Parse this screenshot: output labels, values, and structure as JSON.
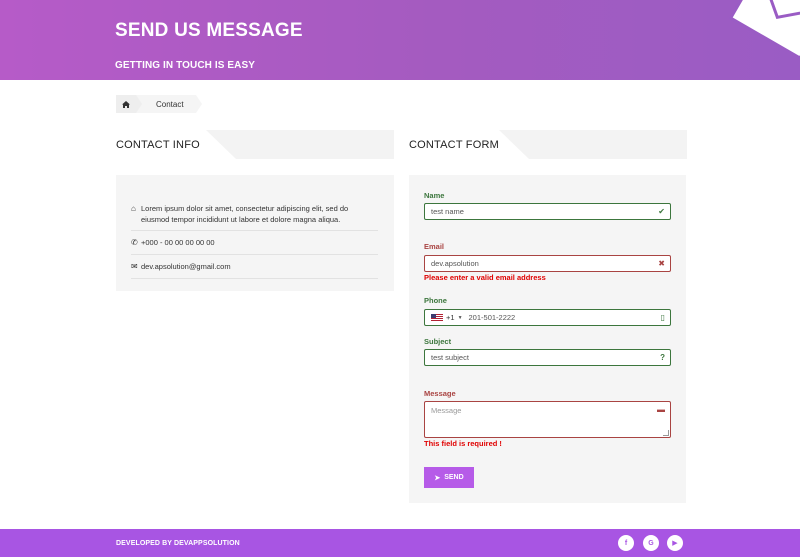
{
  "header": {
    "title": "SEND US MESSAGE",
    "subtitle": "GETTING IN TOUCH IS EASY",
    "icon": "envelope-icon"
  },
  "breadcrumb": {
    "home_icon": "home-icon",
    "current": "Contact"
  },
  "contact_info": {
    "heading": "CONTACT INFO",
    "address": "Lorem ipsum dolor sit amet, consectetur adipiscing elit, sed do eiusmod tempor incididunt ut labore et dolore magna aliqua.",
    "phone": "+000 - 00 00 00 00 00",
    "email": "dev.apsolution@gmail.com"
  },
  "contact_form": {
    "heading": "CONTACT FORM",
    "name": {
      "label": "Name",
      "value": "test name",
      "state": "valid"
    },
    "email": {
      "label": "Email",
      "value": "dev.apsolution",
      "state": "invalid",
      "error": "Please enter a valid email address"
    },
    "phone": {
      "label": "Phone",
      "dial_code": "+1",
      "value": "201-501-2222",
      "state": "valid"
    },
    "subject": {
      "label": "Subject",
      "value": "test subject",
      "state": "valid"
    },
    "message": {
      "label": "Message",
      "placeholder": "Message",
      "state": "invalid",
      "error": "This field is required !"
    },
    "send_label": "SEND"
  },
  "footer": {
    "text": "DEVELOPED BY DEVAPPSOLUTION",
    "social": [
      {
        "icon": "facebook-icon",
        "glyph": "f"
      },
      {
        "icon": "google-icon",
        "glyph": "G"
      },
      {
        "icon": "youtube-icon",
        "glyph": "▶"
      }
    ]
  },
  "colors": {
    "header_gradient_start": "#b65bc8",
    "header_gradient_end": "#9a5cc4",
    "valid": "#3c763d",
    "invalid": "#a94442",
    "error_text": "#e00000",
    "button": "#b65be8",
    "footer": "#a855e3"
  }
}
